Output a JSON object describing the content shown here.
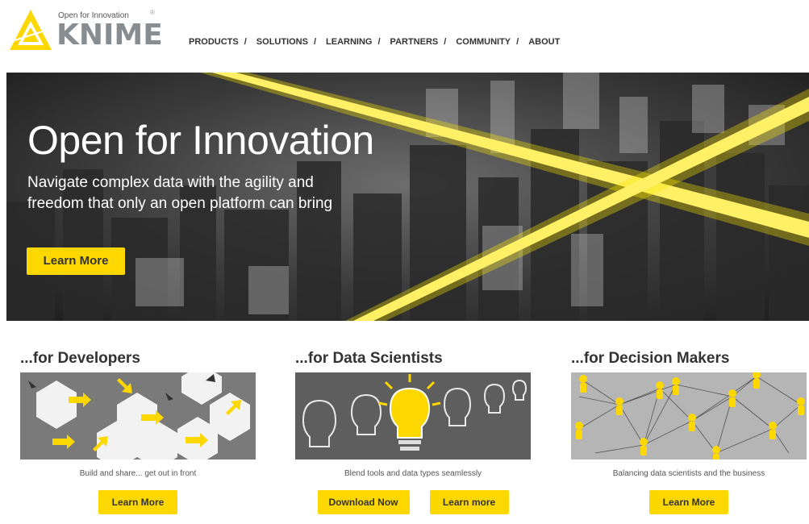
{
  "brand": {
    "tagline": "Open for Innovation",
    "wordmark": "KNIME",
    "registered": "®",
    "color_yellow": "#fdd800",
    "color_grey": "#888d92"
  },
  "nav": {
    "items": [
      "PRODUCTS",
      "SOLUTIONS",
      "LEARNING",
      "PARTNERS",
      "COMMUNITY",
      "ABOUT"
    ],
    "separator": "/"
  },
  "hero": {
    "title": "Open for Innovation",
    "subtitle": "Navigate complex data with the agility and freedom that only an open platform can bring",
    "button": "Learn More"
  },
  "columns": [
    {
      "title": "...for Developers",
      "caption": "Build and share... get out in front",
      "image_icon": "puzzle-pieces-image",
      "buttons": [
        "Learn More"
      ]
    },
    {
      "title": "...for Data Scientists",
      "caption": "Blend tools and data types seamlessly",
      "image_icon": "light-bulbs-image",
      "buttons": [
        "Download Now",
        "Learn more"
      ]
    },
    {
      "title": "...for Decision Makers",
      "caption": "Balancing data scientists and the business",
      "image_icon": "network-people-image",
      "buttons": [
        "Learn More"
      ]
    }
  ]
}
